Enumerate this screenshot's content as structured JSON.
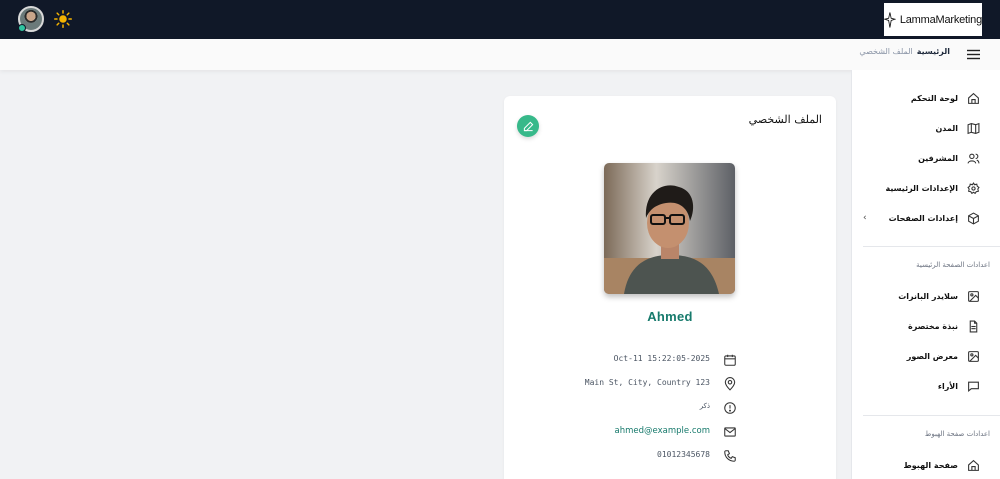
{
  "topbar": {
    "logo_text": "LammaMarketing",
    "avatar_icon": "user-avatar",
    "theme_icon": "sun-icon"
  },
  "breadcrumb": {
    "current": "الرئيسية",
    "previous": "الملف الشخصي"
  },
  "sidebar": {
    "items": [
      {
        "label": "لوحة التحكم",
        "icon": "home-icon"
      },
      {
        "label": "المدن",
        "icon": "map-icon"
      },
      {
        "label": "المشرفين",
        "icon": "users-icon"
      },
      {
        "label": "الإعدادات الرئيسية",
        "icon": "settings-icon"
      },
      {
        "label": "إعدادات الصفحات",
        "icon": "cube-icon"
      }
    ],
    "section1_title": "اعدادات الصفحة الرئيسية",
    "section1_items": [
      {
        "label": "سلايدر البانرات",
        "icon": "image-icon"
      },
      {
        "label": "نبذة مختصرة",
        "icon": "document-icon"
      },
      {
        "label": "معرض الصور",
        "icon": "gallery-icon"
      },
      {
        "label": "الأراء",
        "icon": "chat-icon"
      }
    ],
    "section2_title": "اعدادات صفحة الهبوط",
    "section2_items": [
      {
        "label": "صفحة الهبوط",
        "icon": "home-icon"
      }
    ]
  },
  "profile": {
    "title": "الملف الشخصي",
    "name": "Ahmed",
    "date": "Oct-11 15:22:05-2025",
    "address": "Main St, City, Country 123",
    "gender": "ذكر",
    "email": "ahmed@example.com",
    "phone": "01012345678"
  },
  "colors": {
    "topbar": "#101828",
    "accent": "#37b98a",
    "name_text": "#177a6c"
  }
}
